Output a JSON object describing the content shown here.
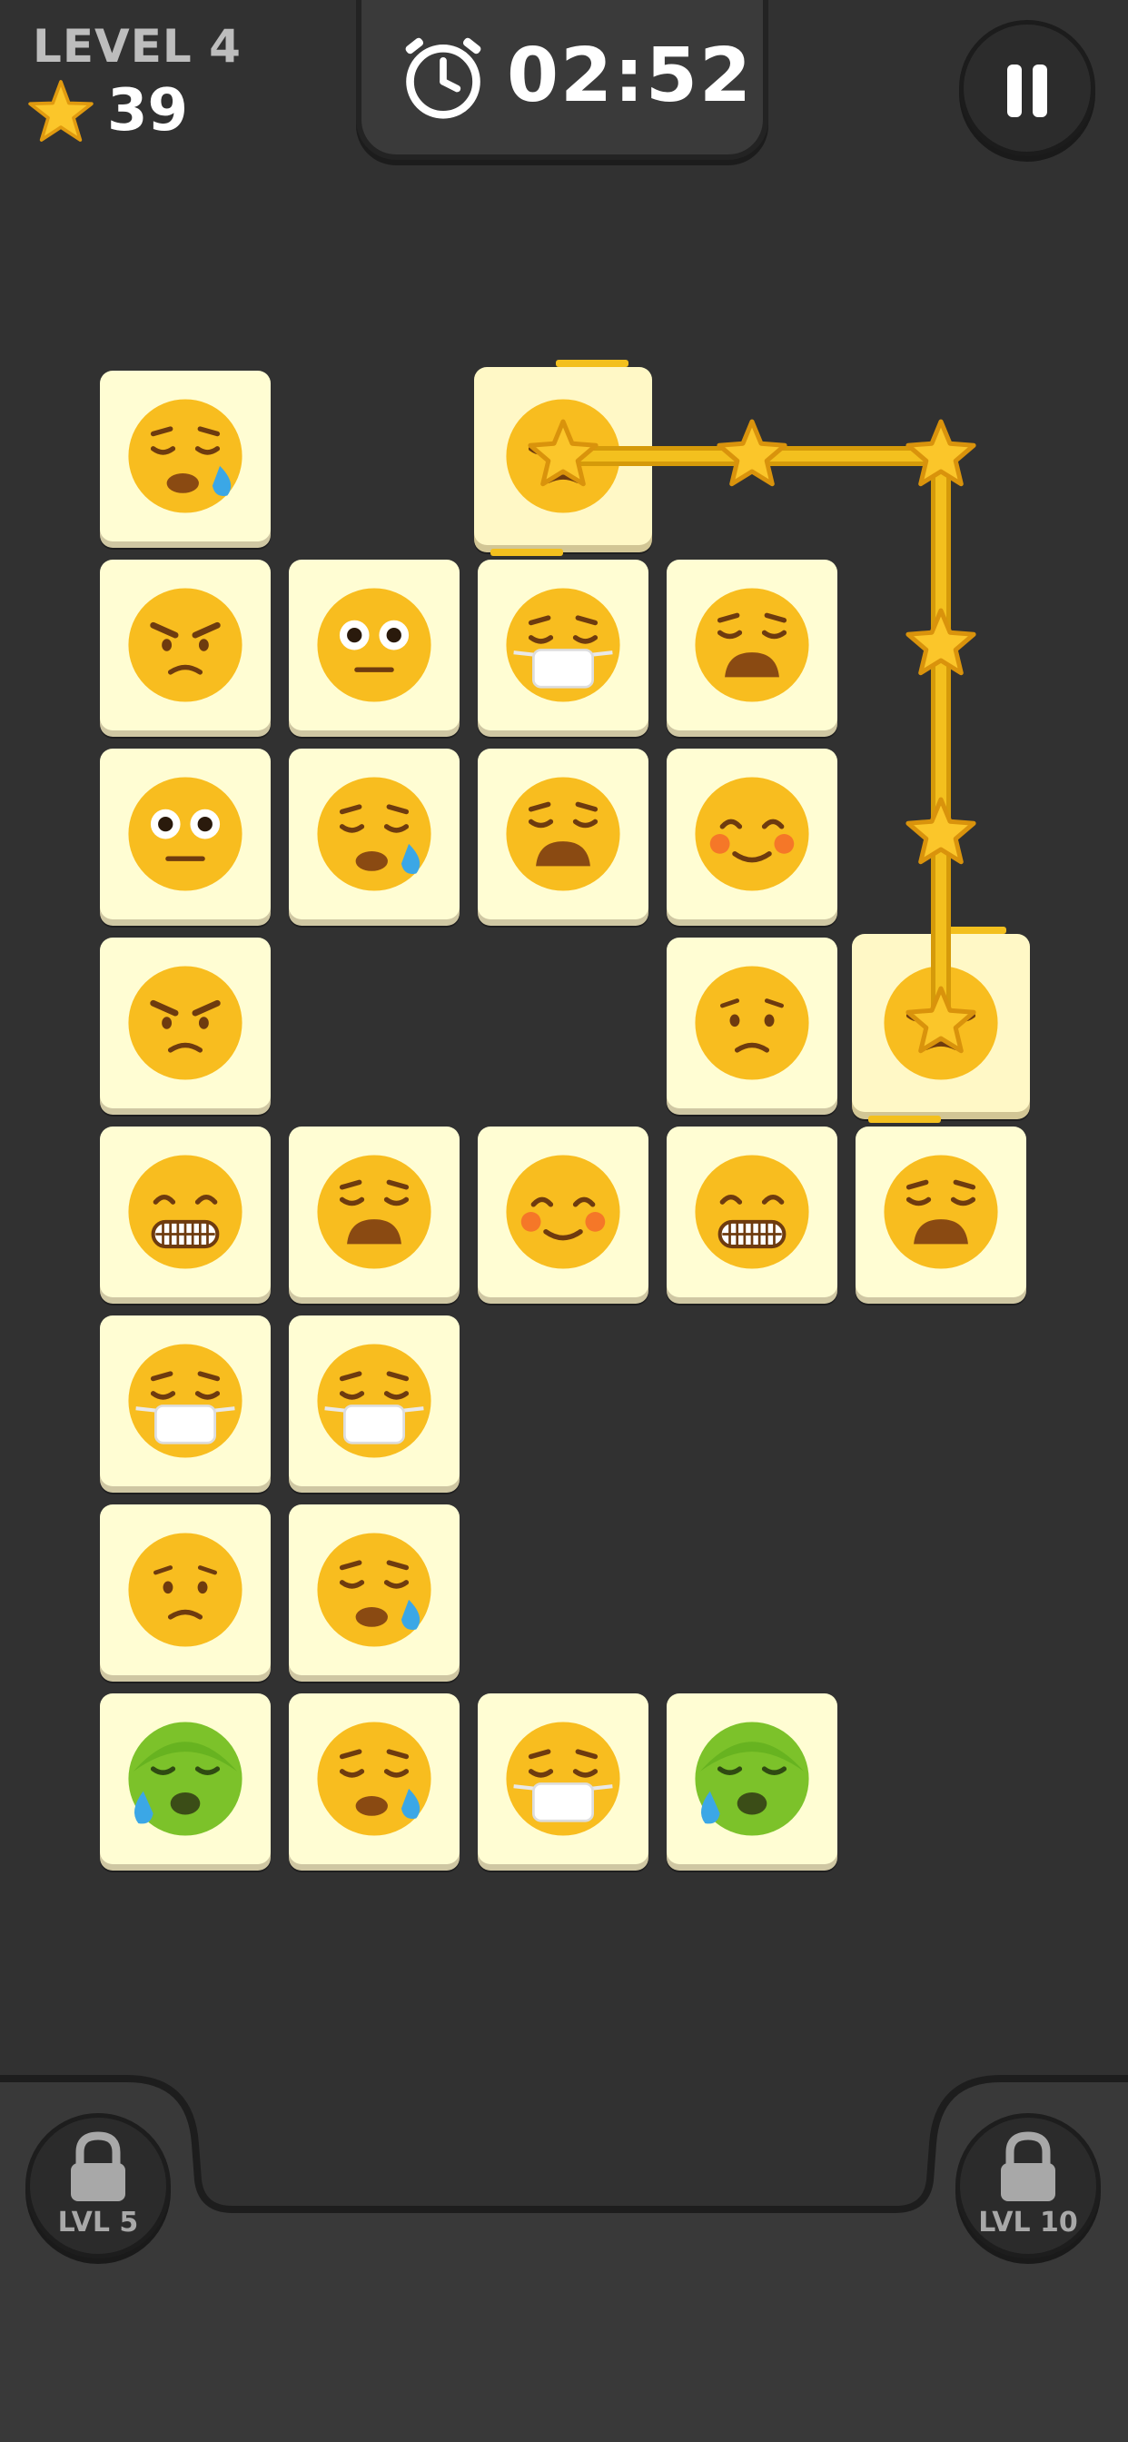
{
  "hud": {
    "level_label": "LEVEL 4",
    "stars_count": "39",
    "timer": "02:52"
  },
  "bottom": {
    "left_lock_label": "LVL 5",
    "right_lock_label": "LVL 10"
  },
  "board": {
    "columns": 5,
    "rows": 8,
    "cells": [
      [
        "sweat",
        null,
        "sleepy",
        null,
        null
      ],
      [
        "angry",
        "flushed",
        "mask",
        "weary",
        null
      ],
      [
        "flushed",
        "sweat",
        "weary",
        "blush",
        null
      ],
      [
        "angry",
        null,
        null,
        "worried",
        "sleepy"
      ],
      [
        "grimace",
        "weary",
        "blush",
        "grimace",
        "weary"
      ],
      [
        "mask",
        "mask",
        null,
        null,
        null
      ],
      [
        "worried",
        "sweat",
        null,
        null,
        null
      ],
      [
        "sick",
        "sweat",
        "mask",
        "sick",
        null
      ]
    ],
    "selected": [
      [
        0,
        2
      ],
      [
        3,
        4
      ]
    ],
    "connection_path": [
      [
        0,
        2
      ],
      [
        0,
        3
      ],
      [
        0,
        4
      ],
      [
        1,
        4
      ],
      [
        2,
        4
      ],
      [
        3,
        4
      ]
    ]
  },
  "colors": {
    "background": "#313131",
    "tile": "#fffdd3",
    "path": "#f3c01e",
    "face": "#f7b91c"
  }
}
